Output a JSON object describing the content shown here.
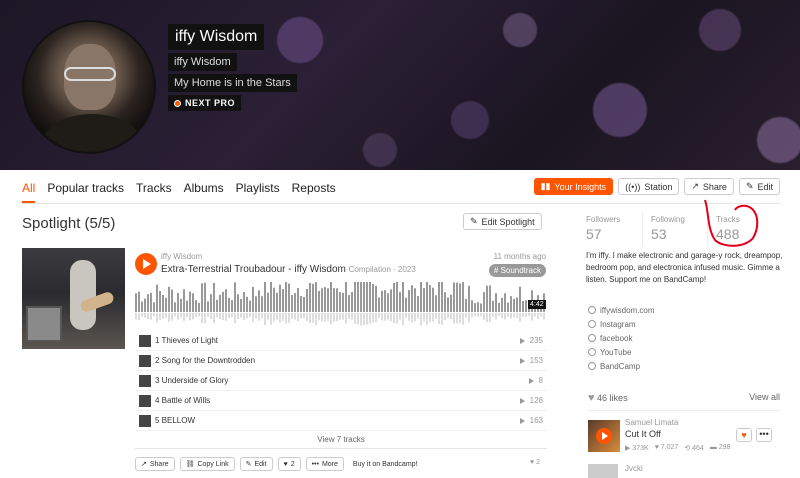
{
  "profile": {
    "name": "iffy Wisdom",
    "username": "iffy Wisdom",
    "tagline": "My Home is in the Stars",
    "badge": "NEXT PRO"
  },
  "nav": {
    "tabs": [
      "All",
      "Popular tracks",
      "Tracks",
      "Albums",
      "Playlists",
      "Reposts"
    ]
  },
  "actions": {
    "insights": "Your Insights",
    "station": "Station",
    "share": "Share",
    "edit": "Edit"
  },
  "spotlight": {
    "title": "Spotlight (5/5)",
    "edit_label": "Edit Spotlight",
    "uploader": "iffy Wisdom",
    "track_title": "Extra-Terrestrial Troubadour - iffy Wisdom",
    "compilation": "Compilation · 2023",
    "ago": "11 months ago",
    "tag": "# Soundtrack",
    "duration": "4:42",
    "tracks": [
      {
        "name": "1 Thieves of Light",
        "plays": "235"
      },
      {
        "name": "2 Song for the Downtrodden",
        "plays": "153"
      },
      {
        "name": "3 Underside of Glory",
        "plays": "8"
      },
      {
        "name": "4 Battle of Wills",
        "plays": "128"
      },
      {
        "name": "5 BELLOW",
        "plays": "163"
      }
    ],
    "view_more": "View 7 tracks",
    "share": "Share",
    "copy_link": "Copy Link",
    "edit": "Edit",
    "likes": "2",
    "more": "More",
    "buy": "Buy it on Bandcamp!",
    "like_count": "2"
  },
  "stats": {
    "followers_label": "Followers",
    "followers": "57",
    "following_label": "Following",
    "following": "53",
    "tracks_label": "Tracks",
    "tracks": "488"
  },
  "bio": "I'm iffy. I make electronic and garage-y rock, dreampop, bedroom pop, and electronica infused music. Gimme a listen. Support me on BandCamp!",
  "links": [
    "iffywisdom.com",
    "Instagram",
    "facebook",
    "YouTube",
    "BandCamp"
  ],
  "likes": {
    "count_label": "46 likes",
    "view_all": "View all",
    "item": {
      "user": "Samuel Limata",
      "title": "Cut It Off",
      "plays": "373K",
      "likes": "7,027",
      "reposts": "464",
      "comments": "298"
    },
    "next_user": "Jvcki"
  },
  "colors": {
    "accent": "#ff5500"
  }
}
